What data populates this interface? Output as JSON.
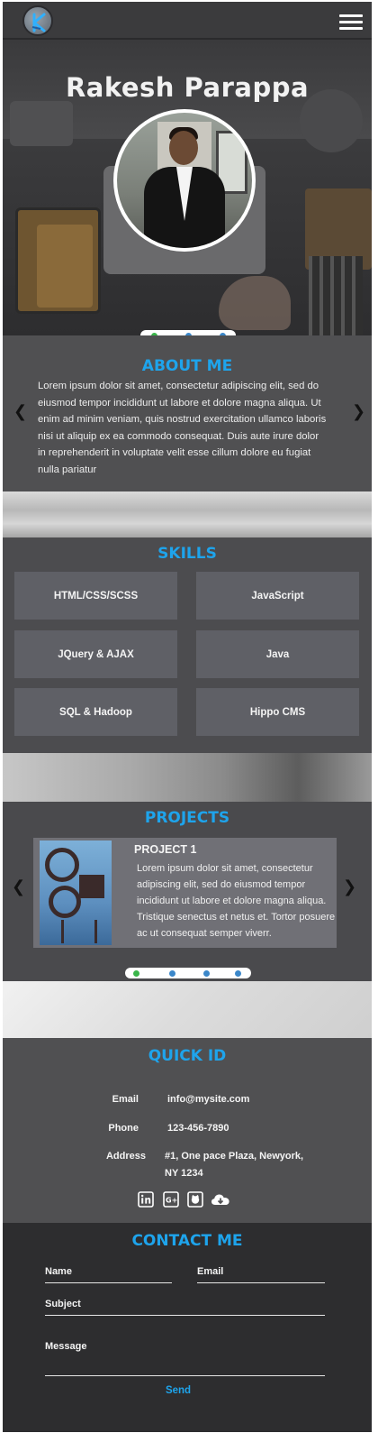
{
  "nav": {
    "logo_icon": "k-logo-icon",
    "menu_icon": "hamburger-menu-icon"
  },
  "hero": {
    "name": "Rakesh Parappa",
    "carousel_dots": 3,
    "active_dot": 0
  },
  "about": {
    "title": "ABOUT ME",
    "text": "Lorem ipsum dolor sit amet, consectetur adipiscing elit, sed do eiusmod tempor incididunt ut labore et dolore magna aliqua. Ut enim ad minim veniam, quis nostrud exercitation ullamco laboris nisi ut aliquip ex ea commodo consequat. Duis aute irure dolor in reprehenderit in voluptate velit esse cillum dolore eu fugiat nulla pariatur",
    "prev_icon": "chevron-left-icon",
    "next_icon": "chevron-right-icon"
  },
  "skills": {
    "title": "SKILLS",
    "items": [
      "HTML/CSS/SCSS",
      "JavaScript",
      "JQuery & AJAX",
      "Java",
      "SQL & Hadoop",
      "Hippo CMS"
    ]
  },
  "projects": {
    "title": "PROJECTS",
    "card": {
      "title": "PROJECT 1",
      "text": "Lorem ipsum dolor sit amet, consectetur adipiscing elit, sed do eiusmod tempor incididunt ut labore et dolore magna aliqua. Tristique senectus et netus et. Tortor posuere ac ut consequat semper viverr."
    },
    "carousel_dots": 4,
    "active_dot": 0
  },
  "quick_id": {
    "title": "QUICK ID",
    "email_label": "Email",
    "email_value": "info@mysite.com",
    "phone_label": "Phone",
    "phone_value": "123-456-7890",
    "address_label": "Address",
    "address_line1": "#1, One pace Plaza,  Newyork,",
    "address_line2": "NY 1234",
    "social_icons": [
      "linkedin-icon",
      "google-plus-icon",
      "github-icon",
      "cloud-download-icon"
    ]
  },
  "contact": {
    "title": "CONTACT ME",
    "name_label": "Name",
    "email_label": "Email",
    "subject_label": "Subject",
    "message_label": "Message",
    "send_label": "Send"
  },
  "colors": {
    "accent": "#1ea4ec",
    "dot_active": "#3ab54a",
    "dot": "#3b87c9"
  }
}
